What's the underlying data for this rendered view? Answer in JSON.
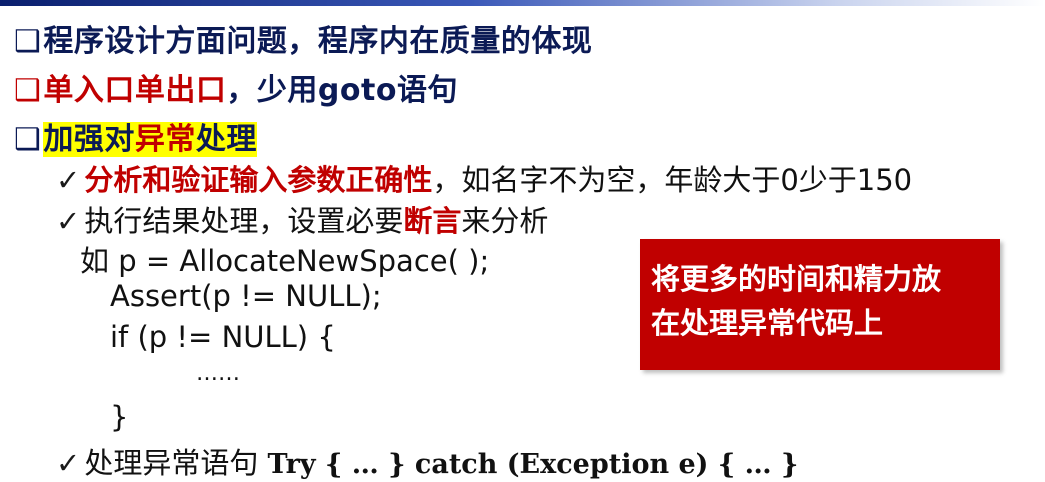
{
  "bullet_symbol": "❑",
  "check_symbol": "✓",
  "headings": [
    {
      "text": "程序设计方面问题，程序内在质量的体现"
    },
    {
      "text_red": "单入口单出口",
      "text_rest": "，少用goto语句"
    },
    {
      "prefix": "加强对",
      "emphasis": "异常",
      "suffix": "处理"
    }
  ],
  "items": {
    "validate": {
      "bold": "分析和验证输入参数正确性",
      "rest": "，如名字不为空，年龄大于0少于150"
    },
    "assert": {
      "prefix": "执行结果处理，设置必要",
      "bold": "断言",
      "suffix": "来分析"
    },
    "exception": {
      "prefix": "处理异常语句 ",
      "code": "Try { … }  catch (Exception e) { … }"
    }
  },
  "code_lines": [
    "如 p = AllocateNewSpace( );",
    "Assert(p !=  NULL);",
    "if (p !=  NULL)  {",
    "……",
    "}"
  ],
  "callout": {
    "line1": "将更多的时间和精力放",
    "line2": "在处理异常代码上"
  }
}
